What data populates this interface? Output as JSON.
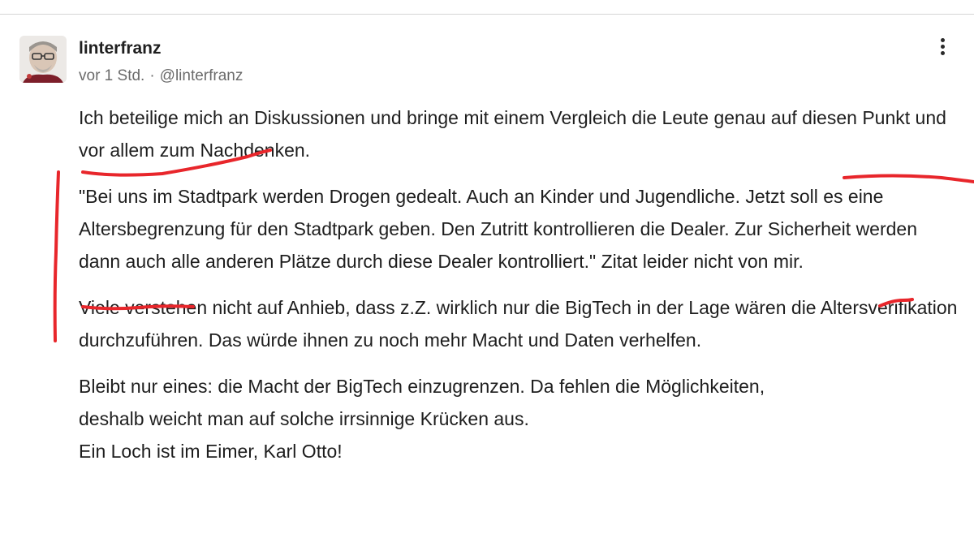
{
  "post": {
    "author": "linterfranz",
    "time": "vor 1 Std.",
    "separator": "·",
    "handle": "@linterfranz",
    "paragraphs": [
      "Ich beteilige mich an Diskussionen und bringe mit einem Vergleich die Leute genau auf diesen Punkt und vor allem zum Nachdenken.",
      "\"Bei uns im Stadtpark werden Drogen gedealt. Auch an Kinder und Jugendliche. Jetzt soll es eine Altersbegrenzung für den Stadtpark geben. Den Zutritt kontrollieren die Dealer. Zur Sicherheit werden dann auch alle anderen Plätze durch diese Dealer kontrolliert.\" Zitat leider nicht von mir.",
      "Viele verstehen nicht auf Anhieb, dass z.Z. wirklich nur die BigTech in der Lage wären die Altersverifikation durchzuführen. Das würde ihnen zu noch mehr Macht und Daten verhelfen."
    ],
    "closing_lines": [
      "Bleibt nur eines: die Macht der BigTech einzugrenzen. Da fehlen die Möglichkeiten,",
      "deshalb weicht man auf solche irrsinnige Krücken aus.",
      "Ein Loch ist im Eimer, Karl Otto!"
    ]
  },
  "colors": {
    "annotation": "#e8262b",
    "text": "#1e1e1e",
    "meta": "#6b6b6b"
  },
  "icons": [
    "avatar",
    "more-vertical-icon"
  ]
}
